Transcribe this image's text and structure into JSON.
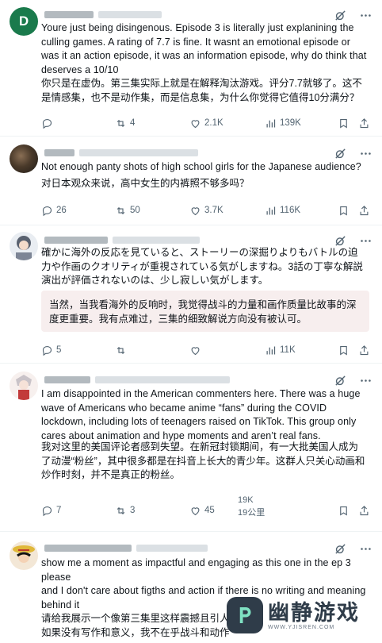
{
  "tweets": [
    {
      "avatar_letter": "D",
      "text_en": "Youre just being disingenous. Episode 3 is literally just explanining the culling games. A rating of 7.7 is fine. It wasnt an emotional episode or was it an action episode, it was an information episode, why do think that deserves a 10/10",
      "text_zh": "你只是在虚伪。第三集实际上就是在解释淘汰游戏。评分7.7就够了。这不是情感集，也不是动作集，而是信息集，为什么你觉得它值得10分满分？",
      "replies": "",
      "retweets": "4",
      "likes": "2.1K",
      "views": "139K"
    },
    {
      "text_en": "Not enough panty shots of high school girls for the Japanese audience?",
      "text_zh": "对日本观众来说，高中女生的内裤照不够多吗？",
      "replies": "26",
      "retweets": "50",
      "likes": "3.7K",
      "views": "116K"
    },
    {
      "text_ja": "確かに海外の反応を見ていると、ストーリーの深掘りよりもバトルの迫力や作画のクオリティが重視されている気がしますね。3話の丁寧な解説演出が評価されないのは、少し寂しい気がします。",
      "text_zh": "当然，当我看海外的反响时，我觉得战斗的力量和画作质量比故事的深度更重要。我有点难过，三集的细致解说方向没有被认可。",
      "replies": "5",
      "retweets": "",
      "likes": "",
      "views": "11K"
    },
    {
      "text_en": "I am disappointed in the American commenters here. There was a huge wave of Americans who became anime “fans” during the COVID lockdown, including lots of teenagers raised on TikTok. This group only cares about animation and hype moments and aren’t real fans.",
      "text_zh": "我对这里的美国评论者感到失望。在新冠封锁期间，有一大批美国人成为了动漫“粉丝”，其中很多都是在抖音上长大的青少年。这群人只关心动画和炒作时刻，并不是真正的粉丝。",
      "replies": "7",
      "retweets": "3",
      "likes": "45",
      "views": "19K",
      "views_zh": "19公里"
    },
    {
      "text_en": "show me a moment as impactful and engaging as this one in the ep 3 please\nand I don't care about figths and action if there is no writing and meaning behind it",
      "text_zh": "请给我展示一个像第三集里这样震撼且引人\n如果没有写作和意义，我不在乎战斗和动作"
    }
  ],
  "watermark": {
    "title": "幽静游戏",
    "url": "WWW.YJISREN.COM"
  },
  "colors": {
    "text": "#0f1419",
    "muted": "#536471",
    "divider": "#eff3f4",
    "quote_bg": "#f7eeee",
    "avatar_green": "#1a7a4c"
  },
  "icons": [
    "reply-icon",
    "retweet-icon",
    "like-icon",
    "views-icon",
    "bookmark-icon",
    "share-icon",
    "grok-icon",
    "more-icon"
  ]
}
